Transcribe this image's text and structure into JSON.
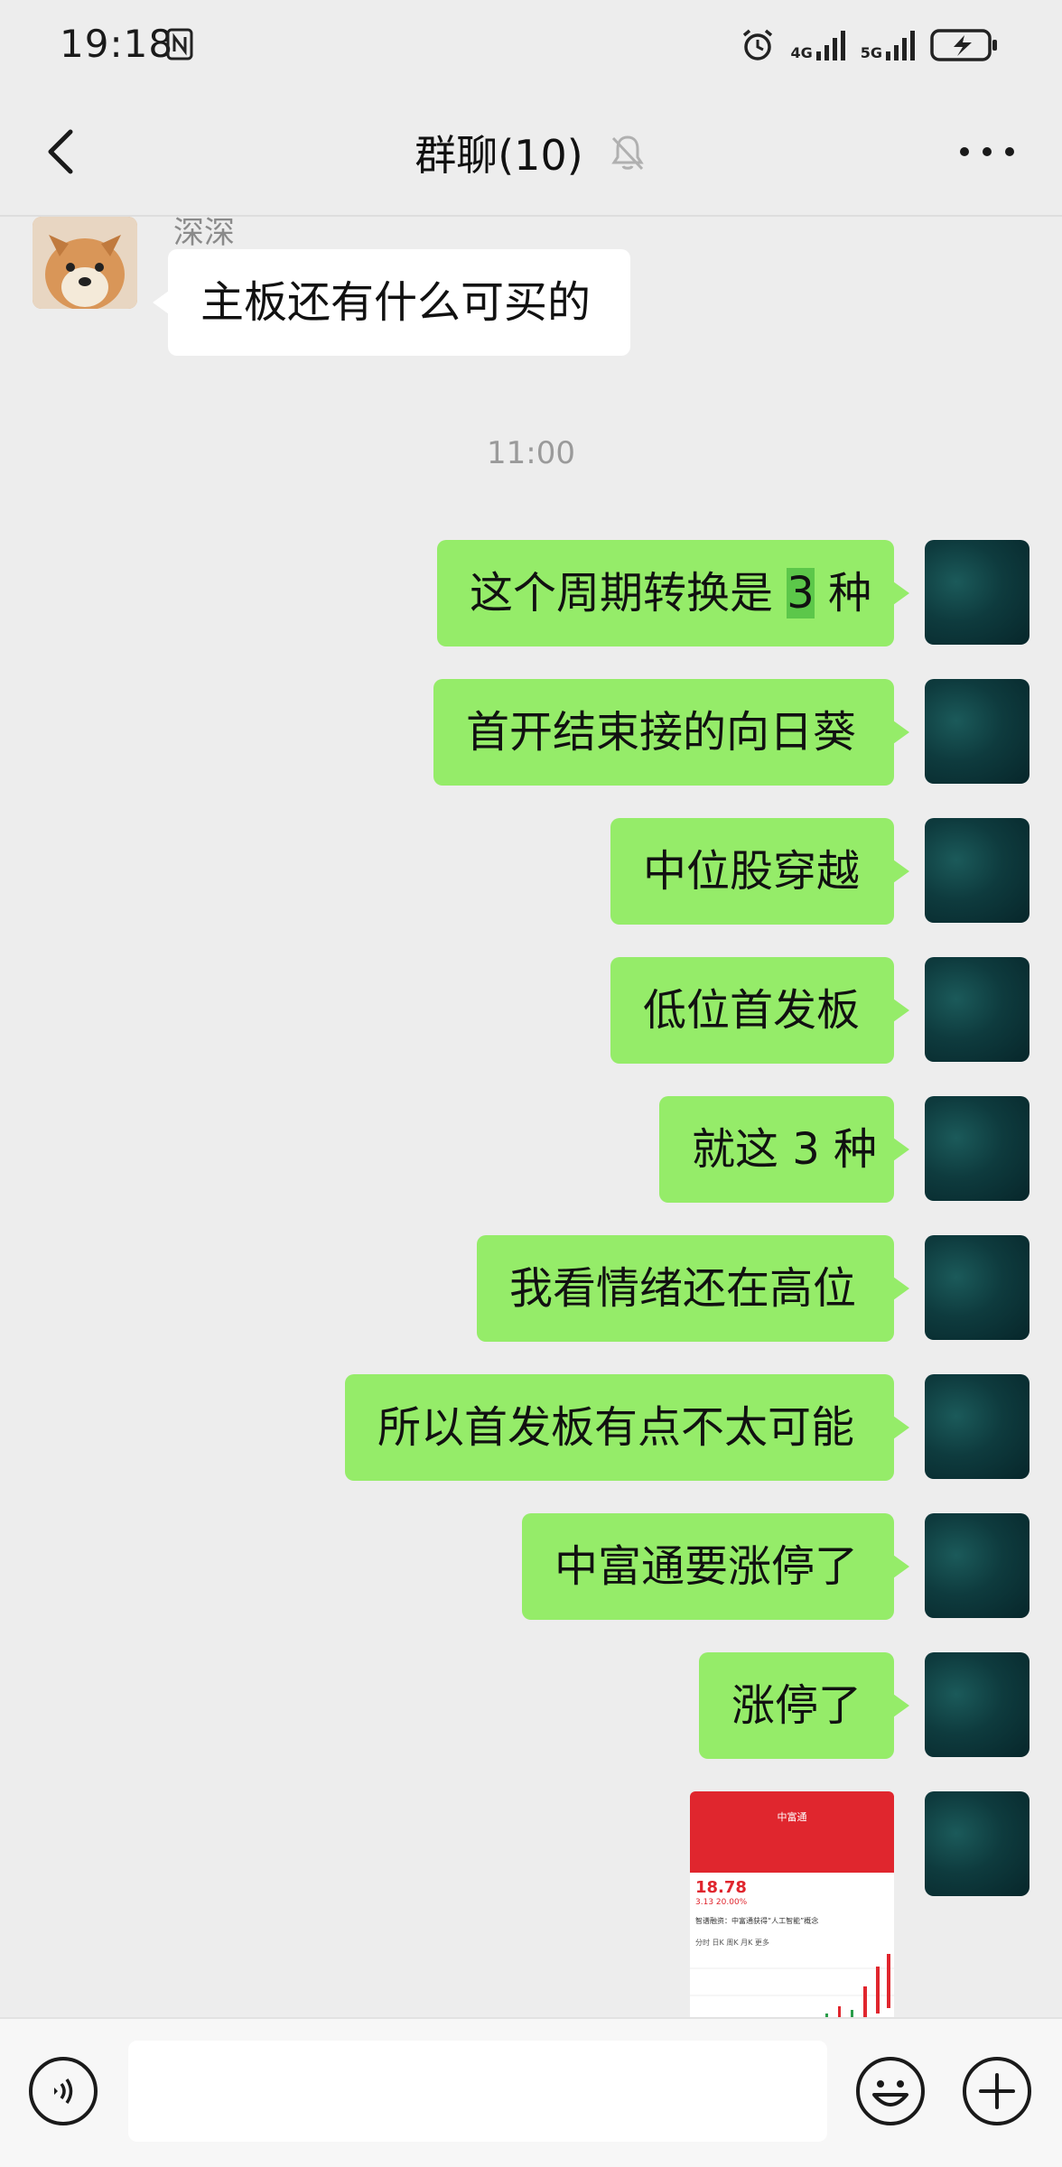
{
  "status_bar": {
    "time": "19:18",
    "network_1": "4G",
    "network_2": "5G",
    "icons": [
      "nfc-icon",
      "alarm-icon",
      "signal-icon",
      "battery-charging-icon"
    ]
  },
  "header": {
    "title": "群聊(10)",
    "icons": [
      "back-arrow-icon",
      "bell-muted-icon",
      "more-dots-icon"
    ]
  },
  "messages": {
    "incoming": {
      "sender": "深深",
      "text": "主板还有什么可买的"
    },
    "time_divider": "11:00",
    "first_outgoing": {
      "before": "这个周期转换是 ",
      "highlight": "3",
      "after": " 种"
    },
    "outgoing": [
      "首开结束接的向日葵",
      "中位股穿越",
      "低位首发板",
      "就这 3 种",
      "我看情绪还在高位",
      "所以首发板有点不太可能",
      "中富通要涨停了",
      "涨停了"
    ],
    "screenshot": {
      "title": "中富通",
      "price": "18.78",
      "change": "3.13  20.00%",
      "note": "智谱融资：中富通获得“人工智能”概念",
      "tabs": "分时  日K  周K  月K  更多"
    }
  },
  "input_bar": {
    "placeholder": "",
    "icons": [
      "voice-icon",
      "emoji-icon",
      "plus-icon"
    ]
  },
  "colors": {
    "background": "#ededed",
    "outgoing_bubble": "#95ec69",
    "incoming_bubble": "#ffffff",
    "highlight": "#5cc74a",
    "stock_red": "#e0262e"
  }
}
